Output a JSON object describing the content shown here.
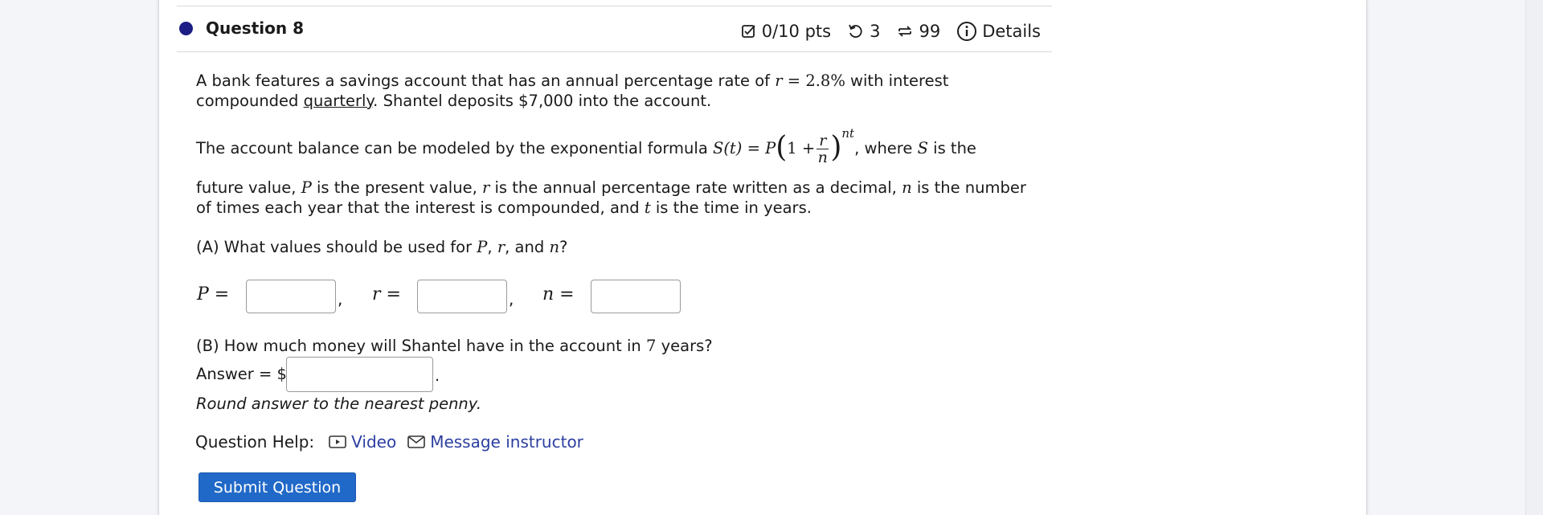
{
  "question": {
    "title": "Question 8",
    "meta": {
      "score": "0/10 pts",
      "retries": "3",
      "attempts": "99",
      "details_label": "Details"
    },
    "text": {
      "p1_a": "A bank features a savings account that has an annual percentage rate of ",
      "p1_r": "r",
      "p1_eq": " = 2.8%",
      "p1_b": " with interest compounded ",
      "p1_underline": "quarterly",
      "p1_c": ". Shantel deposits $7,000 into the account.",
      "p2_a": "The account balance can be modeled by the exponential formula ",
      "formula_left": "S(t) = P",
      "formula_one": "1 +",
      "formula_num": "r",
      "formula_den": "n",
      "formula_exp": "nt",
      "p2_b": ", where ",
      "p2_S": "S",
      "p2_c": " is the",
      "p2_d": "future value, ",
      "p2_P": "P",
      "p2_e": " is the present value, ",
      "p2_r": "r",
      "p2_f": " is the annual percentage rate written as a decimal, ",
      "p2_n": "n",
      "p2_g": " is the number",
      "p2_h": "of times each year that the interest is compounded, and ",
      "p2_t": "t",
      "p2_i": " is the time in years.",
      "partA_a": "(A) What values should be used for ",
      "partA_P": "P",
      "partA_sep1": ", ",
      "partA_r": "r",
      "partA_sep2": ", and ",
      "partA_n": "n",
      "partA_end": "?",
      "partB_a": "(B) How much money will Shantel have in the account in ",
      "partB_years": "7",
      "partB_b": " years?",
      "answer_label": "Answer = $",
      "round_note": "Round answer to the nearest penny."
    },
    "inputs": {
      "P_label": "P =",
      "r_label": "r =",
      "n_label": "n =",
      "P_value": "",
      "r_value": "",
      "n_value": "",
      "answer_value": ""
    },
    "help": {
      "label": "Question Help:",
      "video": "Video",
      "message": "Message instructor"
    },
    "submit_label": "Submit Question"
  },
  "colors": {
    "accent": "#2169c8",
    "link": "#2c3fa0",
    "dot": "#1c1e85"
  }
}
